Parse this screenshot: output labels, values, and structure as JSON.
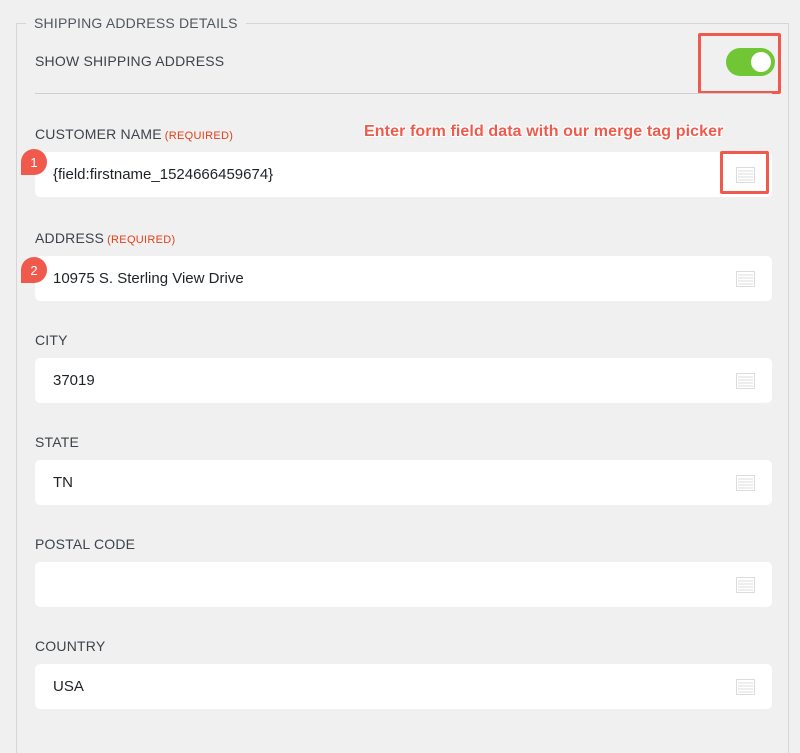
{
  "section": {
    "legend": "SHIPPING ADDRESS DETAILS",
    "toggle_label": "SHOW SHIPPING ADDRESS",
    "toggle_on": true,
    "toggle_color": "#71c636"
  },
  "annotation": {
    "text": "Enter form field data with our merge tag picker",
    "color": "#ef5a4c"
  },
  "badges": [
    "1",
    "2"
  ],
  "fields": {
    "customer_name": {
      "label": "CUSTOMER NAME",
      "required": "(REQUIRED)",
      "value": "{field:firstname_1524666459674}"
    },
    "address": {
      "label": "ADDRESS",
      "required": "(REQUIRED)",
      "value": "10975 S. Sterling View Drive"
    },
    "city": {
      "label": "CITY",
      "value": "37019"
    },
    "state": {
      "label": "STATE",
      "value": "TN"
    },
    "postal_code": {
      "label": "POSTAL CODE",
      "value": ""
    },
    "country": {
      "label": "COUNTRY",
      "value": "USA"
    }
  },
  "icons": {
    "merge_tag": "merge-tag-icon"
  }
}
